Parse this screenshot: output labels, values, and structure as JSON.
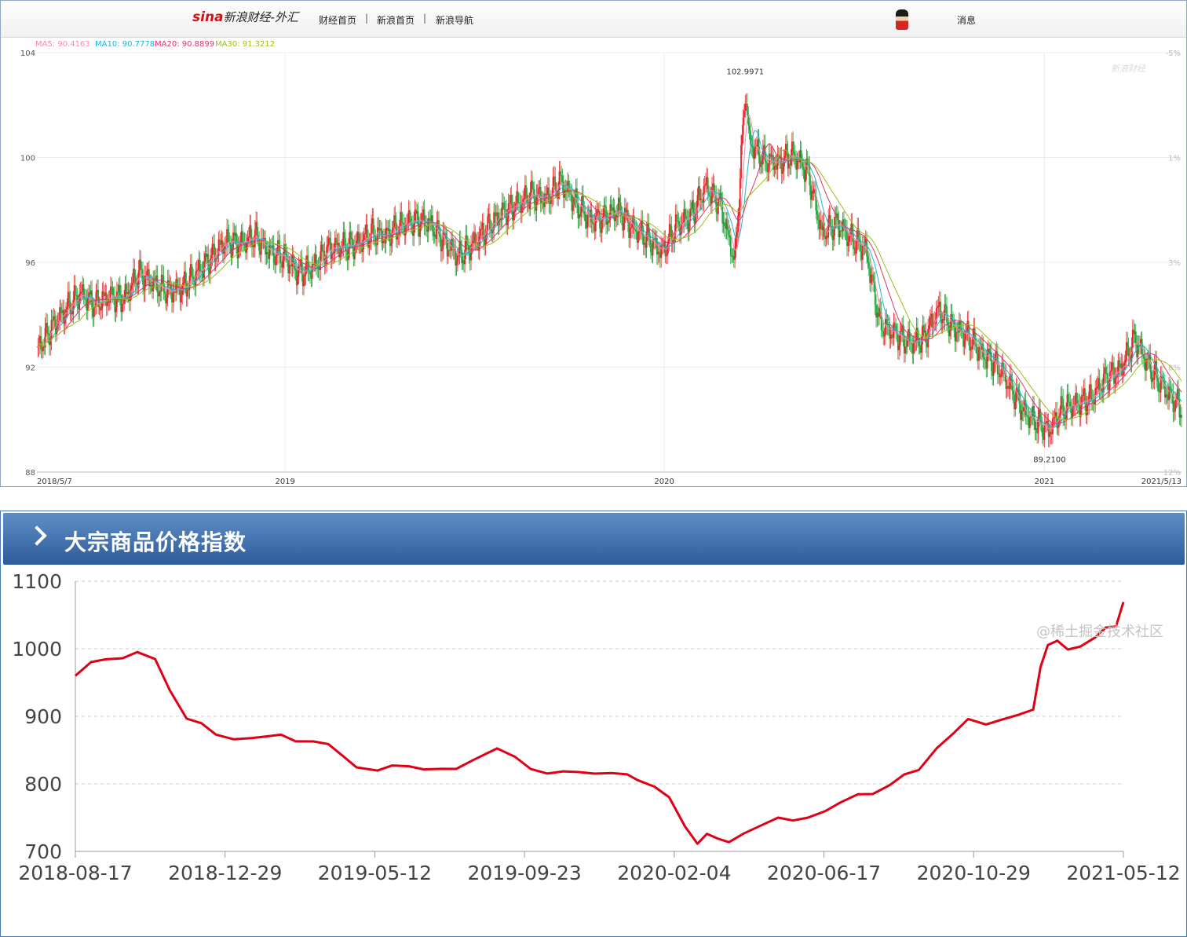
{
  "nav": {
    "logo_brand": "sina",
    "logo_site": "新浪财经-外汇",
    "links": [
      "财经首页",
      "新浪首页",
      "新浪导航"
    ],
    "separator": "|",
    "message": "消息"
  },
  "ma_legend": [
    {
      "label": "MA5: 90.4163",
      "color": "#f28bb2"
    },
    {
      "label": "MA10: 90.7778",
      "color": "#21b4d6"
    },
    {
      "label": "MA20: 90.8899",
      "color": "#e2336b"
    },
    {
      "label": "MA30: 91.3212",
      "color": "#9bbf19"
    }
  ],
  "kline_watermark": "新浪财经",
  "panel_title": "大宗商品价格指数",
  "page_watermark": "@稀土掘金技术社区",
  "colors": {
    "up": "#e8232a",
    "down": "#22a93a",
    "line": "#e00016",
    "header": "#3d6ea8"
  },
  "chart_data": [
    {
      "type": "line",
      "title": "",
      "xlabel": "",
      "ylabel": "",
      "ylim": [
        88,
        104
      ],
      "yticks": [
        88,
        92,
        96,
        100,
        104
      ],
      "ytick_labels": [
        "88",
        "92",
        "96",
        "100",
        "104"
      ],
      "right_ticks": [
        "12%",
        "8%",
        "3%",
        "1%",
        "-5%"
      ],
      "x_tick_labels": [
        "2018/5/7",
        "2019",
        "2020",
        "2021",
        "2021/5/13"
      ],
      "x_tick_dates": [
        "2018-05-07",
        "2019-01-01",
        "2020-01-01",
        "2021-01-01",
        "2021-05-13"
      ],
      "grid": true,
      "annotations": [
        {
          "text": "102.9971",
          "date": "2020-03-19",
          "value": 102.9971
        },
        {
          "text": "89.2100",
          "date": "2021-01-06",
          "value": 89.21
        }
      ],
      "close_series": {
        "name": "",
        "dates": [
          "2018-05-07",
          "2018-05-21",
          "2018-06-04",
          "2018-06-18",
          "2018-07-02",
          "2018-07-16",
          "2018-07-30",
          "2018-08-13",
          "2018-08-27",
          "2018-09-10",
          "2018-09-24",
          "2018-10-08",
          "2018-10-22",
          "2018-11-05",
          "2018-11-19",
          "2018-12-03",
          "2018-12-17",
          "2018-12-31",
          "2019-01-14",
          "2019-01-28",
          "2019-02-11",
          "2019-02-25",
          "2019-03-11",
          "2019-03-25",
          "2019-04-08",
          "2019-04-22",
          "2019-05-06",
          "2019-05-20",
          "2019-06-03",
          "2019-06-17",
          "2019-07-01",
          "2019-07-15",
          "2019-07-29",
          "2019-08-12",
          "2019-08-26",
          "2019-09-09",
          "2019-09-23",
          "2019-10-07",
          "2019-10-21",
          "2019-11-04",
          "2019-11-18",
          "2019-12-02",
          "2019-12-16",
          "2019-12-30",
          "2020-01-13",
          "2020-01-27",
          "2020-02-10",
          "2020-02-24",
          "2020-03-09",
          "2020-03-19",
          "2020-03-23",
          "2020-04-06",
          "2020-04-20",
          "2020-05-04",
          "2020-05-18",
          "2020-06-01",
          "2020-06-15",
          "2020-06-29",
          "2020-07-13",
          "2020-07-27",
          "2020-08-10",
          "2020-08-24",
          "2020-09-07",
          "2020-09-21",
          "2020-10-05",
          "2020-10-19",
          "2020-11-02",
          "2020-11-16",
          "2020-11-30",
          "2020-12-14",
          "2020-12-28",
          "2021-01-06",
          "2021-01-18",
          "2021-02-01",
          "2021-02-15",
          "2021-03-01",
          "2021-03-15",
          "2021-03-29",
          "2021-04-12",
          "2021-04-26",
          "2021-05-13"
        ],
        "values": [
          92.6,
          93.5,
          94.2,
          94.8,
          94.4,
          94.7,
          94.6,
          95.6,
          95.2,
          94.9,
          95.0,
          95.6,
          96.2,
          96.8,
          96.7,
          97.0,
          96.4,
          96.2,
          95.6,
          95.8,
          96.5,
          96.6,
          96.7,
          97.1,
          97.0,
          97.4,
          97.6,
          97.5,
          96.8,
          96.2,
          96.7,
          97.3,
          97.9,
          98.2,
          98.6,
          98.4,
          99.1,
          98.3,
          97.6,
          97.7,
          98.0,
          97.3,
          96.9,
          96.4,
          97.4,
          97.8,
          98.9,
          98.2,
          96.0,
          102.6,
          100.6,
          99.9,
          99.8,
          100.1,
          99.5,
          97.1,
          97.5,
          96.9,
          96.5,
          93.6,
          93.3,
          92.9,
          93.1,
          94.2,
          93.5,
          93.2,
          92.5,
          92.1,
          91.2,
          90.2,
          89.8,
          89.6,
          90.4,
          90.6,
          90.8,
          91.6,
          91.9,
          93.1,
          92.0,
          91.2,
          90.4
        ]
      }
    },
    {
      "type": "line",
      "title": "",
      "xlabel": "",
      "ylabel": "",
      "ylim": [
        700,
        1100
      ],
      "yticks": [
        700,
        800,
        900,
        1000,
        1100
      ],
      "x_tick_labels": [
        "2018-08-17",
        "2018-12-29",
        "2019-05-12",
        "2019-09-23",
        "2020-02-04",
        "2020-06-17",
        "2020-10-29",
        "2021-05-12"
      ],
      "grid": true,
      "series": [
        {
          "name": "",
          "dates": [
            "2018-08-17",
            "2018-09-01",
            "2018-09-15",
            "2018-10-01",
            "2018-10-15",
            "2018-11-01",
            "2018-11-15",
            "2018-12-01",
            "2018-12-15",
            "2018-12-29",
            "2019-01-15",
            "2019-02-01",
            "2019-02-15",
            "2019-03-01",
            "2019-03-15",
            "2019-04-01",
            "2019-04-15",
            "2019-05-01",
            "2019-05-12",
            "2019-06-01",
            "2019-06-15",
            "2019-07-01",
            "2019-07-15",
            "2019-08-01",
            "2019-08-15",
            "2019-09-01",
            "2019-09-23",
            "2019-10-10",
            "2019-10-25",
            "2019-11-10",
            "2019-11-25",
            "2019-12-10",
            "2019-12-25",
            "2020-01-10",
            "2020-01-25",
            "2020-02-04",
            "2020-02-20",
            "2020-03-05",
            "2020-03-20",
            "2020-04-01",
            "2020-04-10",
            "2020-04-20",
            "2020-05-01",
            "2020-05-15",
            "2020-06-01",
            "2020-06-17",
            "2020-07-01",
            "2020-07-15",
            "2020-08-01",
            "2020-08-15",
            "2020-09-01",
            "2020-09-15",
            "2020-10-01",
            "2020-10-15",
            "2020-10-29",
            "2020-11-15",
            "2020-12-01",
            "2020-12-15",
            "2021-01-01",
            "2021-01-15",
            "2021-02-01",
            "2021-02-15",
            "2021-02-22",
            "2021-03-01",
            "2021-03-10",
            "2021-03-20",
            "2021-04-01",
            "2021-04-15",
            "2021-04-25",
            "2021-05-05",
            "2021-05-12"
          ],
          "values": [
            960,
            978,
            985,
            988,
            994,
            983,
            940,
            898,
            888,
            872,
            868,
            868,
            868,
            873,
            865,
            862,
            857,
            840,
            826,
            818,
            826,
            828,
            822,
            820,
            822,
            838,
            852,
            838,
            823,
            817,
            817,
            816,
            817,
            817,
            812,
            805,
            798,
            780,
            735,
            712,
            728,
            718,
            712,
            728,
            740,
            748,
            745,
            752,
            760,
            770,
            785,
            787,
            797,
            812,
            822,
            854,
            873,
            895,
            890,
            895,
            900,
            910,
            975,
            1005,
            1010,
            1000,
            1005,
            1015,
            1030,
            1035,
            1070
          ]
        }
      ]
    }
  ]
}
